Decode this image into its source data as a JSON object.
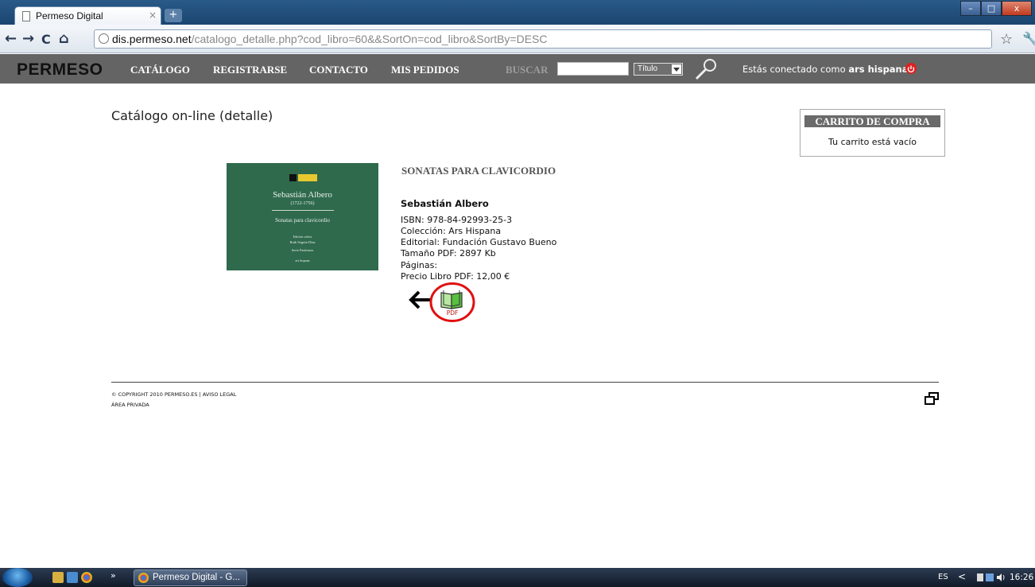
{
  "browser": {
    "tab_title": "Permeso Digital",
    "tab_close": "×",
    "new_tab": "+",
    "url_domain": "dis.permeso.net",
    "url_path": "/catalogo_detalle.php?cod_libro=60&&SortOn=cod_libro&SortBy=DESC",
    "back": "←",
    "forward": "→",
    "reload": "C",
    "home": "⌂",
    "star": "☆",
    "wrench": "🔧",
    "win_min": "–",
    "win_max": "□",
    "win_close": "x"
  },
  "site_header": {
    "logo": "PERMESO",
    "menu": [
      "CATÁLOGO",
      "REGISTRARSE",
      "CONTACTO",
      "MIS PEDIDOS"
    ],
    "search_label": "BUSCAR",
    "search_value": "",
    "search_select": "Título",
    "connected_prefix": "Estás conectado como",
    "connected_user": "ars hispana"
  },
  "main": {
    "page_title": "Catálogo on-line (detalle)",
    "cart": {
      "title": "CARRITO DE COMPRA",
      "empty_message": "Tu carrito está vacío"
    },
    "book": {
      "cover": {
        "author": "Sebastián Albero",
        "years": "(1722-1756)",
        "title": "Sonatas para clavicordio",
        "edition_line1": "Edición crítica",
        "edition_line2": "Ruth Seguín Díaz",
        "series": "Serie Partituras",
        "publisher": "ars hispana"
      },
      "title": "SONATAS PARA CLAVICORDIO",
      "author": "Sebastián Albero",
      "isbn": "ISBN: 978-84-92993-25-3",
      "coleccion": "Colección: Ars Hispana",
      "editorial": "Editorial: Fundación Gustavo Bueno",
      "tamano": "Tamaño PDF: 2897 Kb",
      "paginas": "Páginas:",
      "precio": "Precio Libro PDF: 12,00 €",
      "pdf_label": "PDF"
    }
  },
  "footer": {
    "copyright": "© COPYRIGHT 2010 PERMESO.ES | AVISO LEGAL",
    "private_area": "ÁREA PRIVADA"
  },
  "taskbar": {
    "more": "»",
    "task_label": "Permeso Digital - G...",
    "lang": "ES",
    "chevron": "<",
    "clock": "16:26"
  },
  "colors": {
    "header_bg": "#646464",
    "cover_green": "#2f6a4c",
    "highlight_red": "#e01010"
  }
}
